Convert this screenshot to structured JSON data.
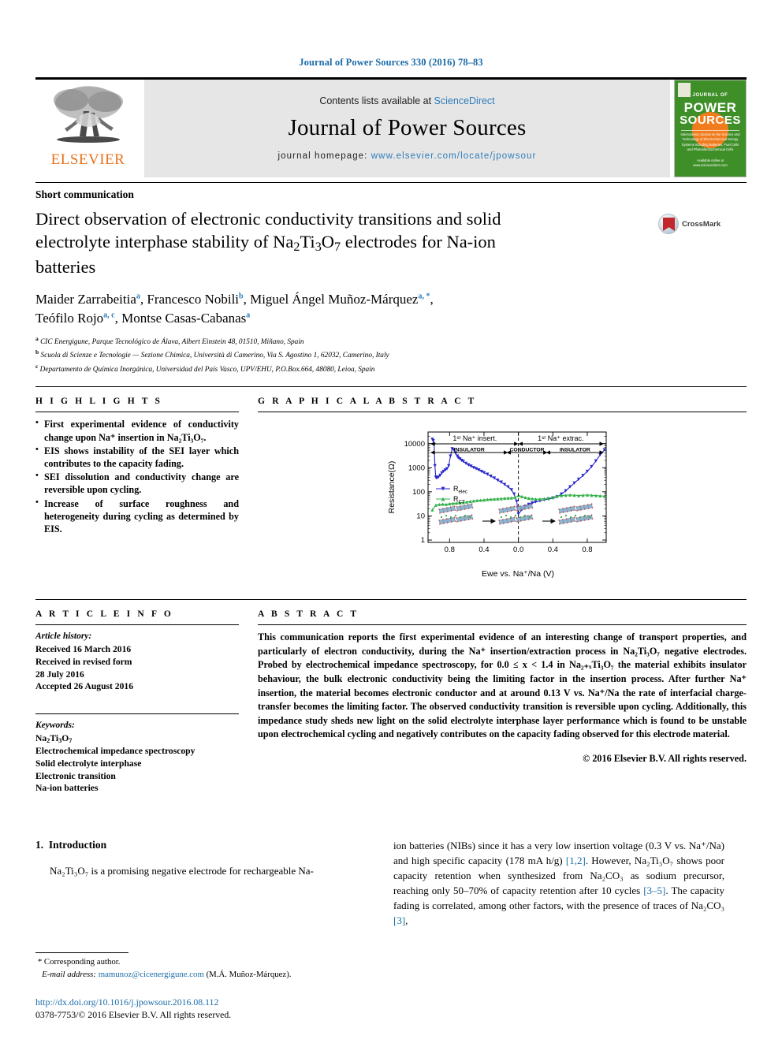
{
  "running_head": "Journal of Power Sources 330 (2016) 78–83",
  "masthead": {
    "contents_prefix": "Contents lists available at ",
    "sciencedirect": "ScienceDirect",
    "journal_name": "Journal of Power Sources",
    "homepage_prefix": "journal homepage: ",
    "homepage_url": "www.elsevier.com/locate/jpowsour",
    "publisher_wordmark": "ELSEVIER",
    "cover": {
      "top_line": "JOURNAL OF",
      "big_line_1": "POWER",
      "big_line_2": "SOURCES",
      "subtitle": "International Journal on the Science and Technology of Electrochemical Energy Systems including Batteries, Fuel Cells and Photoelectrochemical Cells",
      "footer": "Available online at\nwww.sciencedirect.com"
    }
  },
  "article": {
    "type": "Short communication",
    "title_line1": "Direct observation of electronic conductivity transitions and solid",
    "title_line2_a": "electrolyte interphase stability of Na",
    "title_line2_sub1": "2",
    "title_line2_b": "Ti",
    "title_line2_sub2": "3",
    "title_line2_c": "O",
    "title_line2_sub3": "7",
    "title_line2_d": " electrodes for Na-ion",
    "title_line3": "batteries",
    "crossmark_label": "CrossMark"
  },
  "authors": {
    "line1": [
      {
        "name": "Maider Zarrabeitia",
        "marks": "a"
      },
      {
        "name": "Francesco Nobili",
        "marks": "b"
      },
      {
        "name": "Miguel Ángel Muñoz-Márquez",
        "marks": "a, *"
      }
    ],
    "line2": [
      {
        "name": "Teófilo Rojo",
        "marks": "a, c"
      },
      {
        "name": "Montse Casas-Cabanas",
        "marks": "a"
      }
    ],
    "affiliations": [
      {
        "mark": "a",
        "text": "CIC Energigune, Parque Tecnológico de Álava, Albert Einstein 48, 01510, Miñano, Spain"
      },
      {
        "mark": "b",
        "text": "Scuola di Scienze e Tecnologie — Sezione Chimica, Università di Camerino, Via S. Agostino 1, 62032, Camerino, Italy"
      },
      {
        "mark": "c",
        "text": "Departamento de Química Inorgánica, Universidad del País Vasco, UPV/EHU, P.O.Box.664, 48080, Leioa, Spain"
      }
    ]
  },
  "highlights": {
    "heading": "H I G H L I G H T S",
    "items": [
      "First experimental evidence of conductivity change upon Na⁺ insertion in Na₂Ti₃O₇.",
      "EIS shows instability of the SEI layer which contributes to the capacity fading.",
      "SEI dissolution and conductivity change are reversible upon cycling.",
      "Increase of surface roughness and heterogeneity during cycling as determined by EIS."
    ]
  },
  "graphical_abstract": {
    "heading": "G R A P H I C A L   A B S T R A C T"
  },
  "chart_data": {
    "type": "line",
    "title": "",
    "xlabel": "Ewe vs. Na⁺/Na (V)",
    "ylabel": "Resistance(Ω)",
    "xlim": [
      1.05,
      1.02
    ],
    "x_ticks": [
      "0.8",
      "0.4",
      "0.0",
      "0.4",
      "0.8"
    ],
    "x_tick_values": [
      0.8,
      0.4,
      0.0,
      -0.4,
      -0.8
    ],
    "ylim": [
      0.8,
      30000
    ],
    "y_ticks": [
      "1",
      "10",
      "100",
      "1000",
      "10000"
    ],
    "y_scale": "log",
    "grid": false,
    "legend_position": "left-middle",
    "annotations": [
      {
        "text": "1ˢᵗ Na⁺ insert.",
        "region": "left"
      },
      {
        "text": "1ˢᵗ Na⁺ extrac.",
        "region": "right"
      },
      {
        "text": "INSULATOR",
        "region": "left-band"
      },
      {
        "text": "CONDUCTOR",
        "region": "middle-band"
      },
      {
        "text": "INSULATOR",
        "region": "right-band"
      }
    ],
    "series": [
      {
        "name": "R_elec",
        "color": "#2626cc",
        "marker": "triangle-down",
        "x": [
          1.0,
          0.99,
          0.98,
          0.97,
          0.96,
          0.95,
          0.93,
          0.91,
          0.89,
          0.87,
          0.85,
          0.83,
          0.81,
          0.79,
          0.77,
          0.75,
          0.73,
          0.71,
          0.7,
          0.68,
          0.66,
          0.64,
          0.61,
          0.58,
          0.55,
          0.52,
          0.49,
          0.46,
          0.43,
          0.4,
          0.36,
          0.32,
          0.28,
          0.24,
          0.2,
          0.16,
          0.12,
          0.08,
          0.05,
          0.02,
          0.0,
          -0.04,
          -0.08,
          -0.12,
          -0.16,
          -0.2,
          -0.25,
          -0.3,
          -0.35,
          -0.4,
          -0.45,
          -0.5,
          -0.55,
          -0.6,
          -0.65,
          -0.7,
          -0.75,
          -0.8,
          -0.85,
          -0.9,
          -0.95,
          -1.0
        ],
        "y": [
          15000,
          13000,
          9000,
          1200,
          400,
          370,
          400,
          480,
          600,
          700,
          800,
          900,
          1200,
          3000,
          6000,
          5500,
          4000,
          3000,
          2600,
          2300,
          2000,
          1800,
          1500,
          1300,
          1150,
          1000,
          900,
          800,
          700,
          620,
          530,
          440,
          370,
          300,
          250,
          200,
          160,
          120,
          80,
          40,
          12,
          18,
          25,
          30,
          34,
          38,
          42,
          46,
          50,
          55,
          62,
          80,
          110,
          160,
          230,
          330,
          470,
          700,
          1100,
          1900,
          3400,
          5500
        ]
      },
      {
        "name": "R_CT",
        "color": "#33b04a",
        "marker": "triangle-up",
        "x": [
          1.0,
          0.96,
          0.92,
          0.88,
          0.84,
          0.8,
          0.76,
          0.72,
          0.68,
          0.64,
          0.6,
          0.56,
          0.52,
          0.48,
          0.44,
          0.4,
          0.36,
          0.32,
          0.28,
          0.24,
          0.2,
          0.16,
          0.12,
          0.08,
          0.04,
          0.0,
          -0.04,
          -0.08,
          -0.12,
          -0.16,
          -0.2,
          -0.25,
          -0.3,
          -0.35,
          -0.4,
          -0.45,
          -0.5,
          -0.55,
          -0.6,
          -0.65,
          -0.7,
          -0.75,
          -0.8,
          -0.85,
          -0.9,
          -0.95,
          -1.0
        ],
        "y": [
          18,
          28,
          30,
          31,
          30,
          32,
          33,
          34,
          35,
          36,
          38,
          40,
          42,
          44,
          45,
          46,
          48,
          49,
          50,
          51,
          52,
          54,
          55,
          56,
          58,
          70,
          64,
          58,
          54,
          52,
          50,
          50,
          52,
          54,
          58,
          66,
          70,
          72,
          74,
          72,
          70,
          72,
          74,
          72,
          70,
          68,
          66
        ]
      }
    ],
    "legend": [
      "R_elec",
      "R_CT"
    ]
  },
  "article_info": {
    "heading": "A R T I C L E   I N F O",
    "history_label": "Article history:",
    "history": [
      "Received 16 March 2016",
      "Received in revised form",
      "28 July 2016",
      "Accepted 26 August 2016"
    ],
    "keywords_label": "Keywords:",
    "keywords": [
      "Na2Ti3O7",
      "Electrochemical impedance spectroscopy",
      "Solid electrolyte interphase",
      "Electronic transition",
      "Na-ion batteries"
    ]
  },
  "abstract": {
    "heading": "A B S T R A C T",
    "text": "This communication reports the first experimental evidence of an interesting change of transport properties, and particularly of electron conductivity, during the Na⁺ insertion/extraction process in Na₂Ti₃O₇ negative electrodes. Probed by electrochemical impedance spectroscopy, for 0.0 ≤ x < 1.4 in Na₂₊ₓTi₃O₇ the material exhibits insulator behaviour, the bulk electronic conductivity being the limiting factor in the insertion process. After further Na⁺ insertion, the material becomes electronic conductor and at around 0.13 V vs. Na⁺/Na the rate of interfacial charge-transfer becomes the limiting factor. The observed conductivity transition is reversible upon cycling. Additionally, this impedance study sheds new light on the solid electrolyte interphase layer performance which is found to be unstable upon electrochemical cycling and negatively contributes on the capacity fading observed for this electrode material.",
    "copyright": "© 2016 Elsevier B.V. All rights reserved."
  },
  "body": {
    "section_number": "1.",
    "section_title": "Introduction",
    "left_paragraph": "Na₂Ti₃O₇ is a promising negative electrode for rechargeable Na-",
    "right_paragraph_parts": [
      "ion batteries (NIBs) since it has a very low insertion voltage (0.3 V vs. Na⁺/Na) and high specific capacity (178 mA h/g) ",
      "[1,2]",
      ". However, Na₂Ti₃O₇ shows poor capacity retention when synthesized from Na₂CO₃ as sodium precursor, reaching only 50–70% of capacity retention after 10 cycles ",
      "[3–5]",
      ". The capacity fading is correlated, among other factors, with the presence of traces of Na₂CO₃ ",
      "[3]",
      ","
    ]
  },
  "footnote": {
    "star": "*",
    "corresponding": "Corresponding author.",
    "email_label": "E-mail address:",
    "email": "mamunoz@cicenergigune.com",
    "email_owner": "(M.Á. Muñoz-Márquez)."
  },
  "footer": {
    "doi": "http://dx.doi.org/10.1016/j.jpowsour.2016.08.112",
    "issn": "0378-7753/© 2016 Elsevier B.V. All rights reserved."
  },
  "colors": {
    "link_blue": "#1b6ca8",
    "sciencedirect_blue": "#2e7cb8",
    "elsevier_orange": "#E9711C",
    "cover_green": "#3f8f29",
    "series_blue": "#2626cc",
    "series_green": "#33b04a"
  }
}
